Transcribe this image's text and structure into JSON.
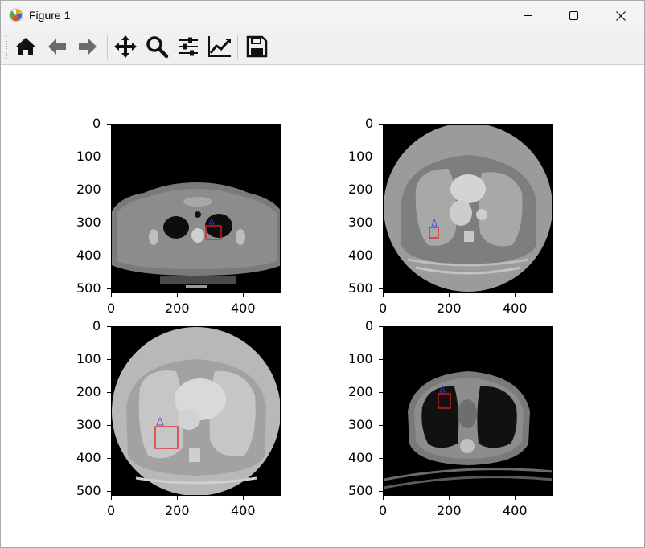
{
  "window": {
    "title": "Figure 1",
    "controls": [
      "minimize",
      "maximize",
      "close"
    ]
  },
  "toolbar": {
    "buttons": [
      {
        "name": "home",
        "icon": "home-icon"
      },
      {
        "name": "back",
        "icon": "arrow-left-icon"
      },
      {
        "name": "forward",
        "icon": "arrow-right-icon"
      },
      {
        "name": "pan",
        "icon": "move-icon"
      },
      {
        "name": "zoom",
        "icon": "magnifier-icon"
      },
      {
        "name": "configure-subplots",
        "icon": "sliders-icon"
      },
      {
        "name": "edit-axes",
        "icon": "line-chart-icon"
      },
      {
        "name": "save",
        "icon": "floppy-disk-icon"
      }
    ]
  },
  "figure": {
    "subplots": [
      {
        "id": "top-left",
        "image": "ct-slice-upper-chest",
        "x_ticks": [
          "0",
          "200",
          "400"
        ],
        "y_ticks": [
          "0",
          "100",
          "200",
          "300",
          "400",
          "500"
        ]
      },
      {
        "id": "top-right",
        "image": "ct-slice-mid-chest-circular",
        "x_ticks": [
          "0",
          "200",
          "400"
        ],
        "y_ticks": [
          "0",
          "100",
          "200",
          "300",
          "400",
          "500"
        ]
      },
      {
        "id": "bottom-left",
        "image": "ct-slice-lower-chest-circular",
        "x_ticks": [
          "0",
          "200",
          "400"
        ],
        "y_ticks": [
          "0",
          "100",
          "200",
          "300",
          "400",
          "500"
        ]
      },
      {
        "id": "bottom-right",
        "image": "ct-slice-mid-chest",
        "x_ticks": [
          "0",
          "200",
          "400"
        ],
        "y_ticks": [
          "0",
          "100",
          "200",
          "300",
          "400",
          "500"
        ]
      }
    ],
    "annotation_colors": {
      "box": "#e02020",
      "marker": "#3a3ae0"
    }
  }
}
